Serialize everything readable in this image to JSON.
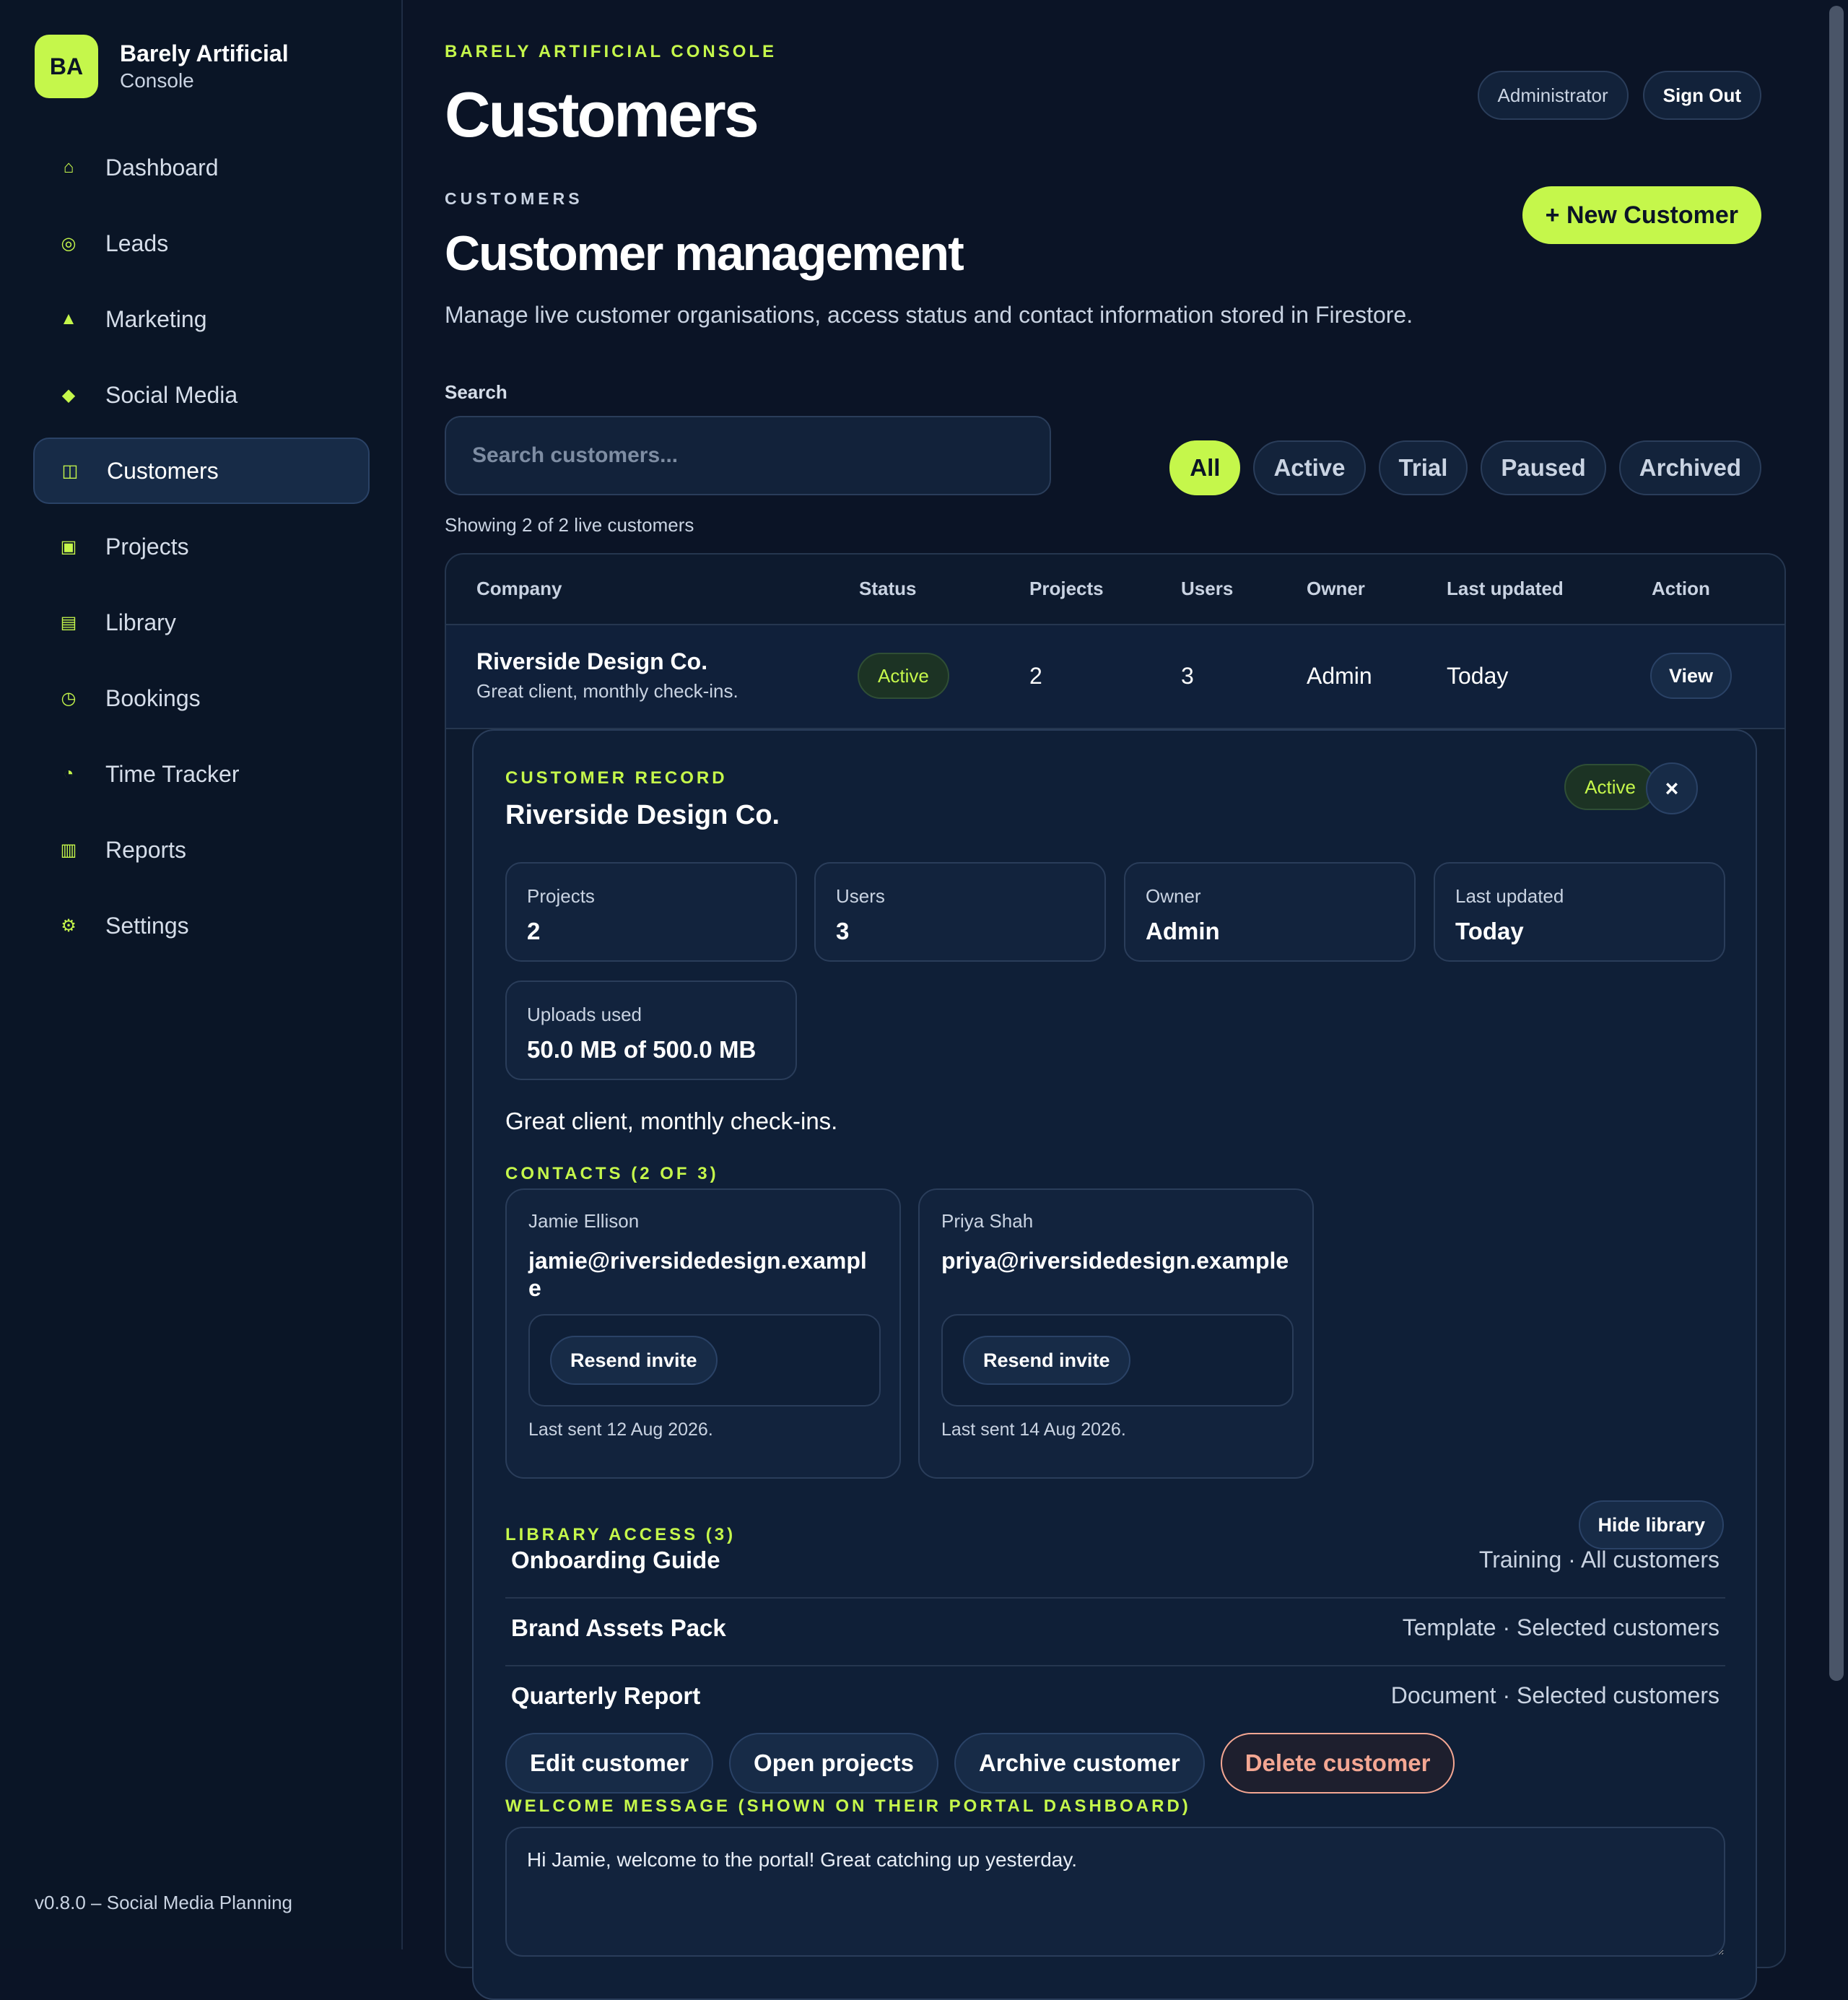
{
  "brand": {
    "logo": "BA",
    "name": "Barely Artificial",
    "sub": "Console"
  },
  "sidebar": {
    "items": [
      {
        "label": "Dashboard",
        "icon": "⌂"
      },
      {
        "label": "Leads",
        "icon": "◎"
      },
      {
        "label": "Marketing",
        "icon": "▲"
      },
      {
        "label": "Social Media",
        "icon": "◆"
      },
      {
        "label": "Customers",
        "icon": "◫"
      },
      {
        "label": "Projects",
        "icon": "▣"
      },
      {
        "label": "Library",
        "icon": "▤"
      },
      {
        "label": "Bookings",
        "icon": "◷"
      },
      {
        "label": "Time Tracker",
        "icon": "◔"
      },
      {
        "label": "Reports",
        "icon": "▥"
      },
      {
        "label": "Settings",
        "icon": "⚙"
      }
    ],
    "active": "Customers",
    "version": "v0.8.0 – Social Media Planning"
  },
  "header": {
    "console_label": "BARELY ARTIFICIAL CONSOLE",
    "title": "Customers",
    "role": "Administrator",
    "sign_out": "Sign Out"
  },
  "section": {
    "label": "CUSTOMERS",
    "title": "Customer management",
    "description": "Manage live customer organisations, access status and contact information stored in Firestore.",
    "new_button": "+ New Customer"
  },
  "search": {
    "label": "Search",
    "placeholder": "Search customers...",
    "value": ""
  },
  "filters": [
    "All",
    "Active",
    "Trial",
    "Paused",
    "Archived"
  ],
  "active_filter": "All",
  "showing": "Showing 2 of 2 live customers",
  "table": {
    "headers": [
      "Company",
      "Status",
      "Projects",
      "Users",
      "Owner",
      "Last updated",
      "Action"
    ],
    "rows": [
      {
        "company": "Riverside Design Co.",
        "note": "Great client, monthly check-ins.",
        "status": "Active",
        "projects": "2",
        "users": "3",
        "owner": "Admin",
        "updated": "Today",
        "action": "View"
      }
    ]
  },
  "record": {
    "eyebrow": "CUSTOMER RECORD",
    "title": "Riverside Design Co.",
    "status": "Active",
    "close": "×",
    "stats": [
      {
        "label": "Projects",
        "value": "2"
      },
      {
        "label": "Users",
        "value": "3"
      },
      {
        "label": "Owner",
        "value": "Admin"
      },
      {
        "label": "Last updated",
        "value": "Today"
      },
      {
        "label": "Uploads used",
        "value": "50.0 MB of 500.0 MB"
      }
    ],
    "note": "Great client, monthly check-ins.",
    "contacts_label": "CONTACTS (2 OF 3)",
    "contacts": [
      {
        "name": "Jamie Ellison",
        "email": "jamie@riversidedesign.example",
        "button": "Resend invite",
        "last_sent": "Last sent 12 Aug 2026."
      },
      {
        "name": "Priya Shah",
        "email": "priya@riversidedesign.example",
        "button": "Resend invite",
        "last_sent": "Last sent 14 Aug 2026."
      }
    ],
    "library_label": "LIBRARY ACCESS (3)",
    "hide_library": "Hide library",
    "library": [
      {
        "name": "Onboarding Guide",
        "meta": "Training · All customers"
      },
      {
        "name": "Brand Assets Pack",
        "meta": "Template · Selected customers"
      },
      {
        "name": "Quarterly Report",
        "meta": "Document · Selected customers"
      }
    ],
    "actions": {
      "edit": "Edit customer",
      "open": "Open projects",
      "archive": "Archive customer",
      "delete": "Delete customer"
    },
    "welcome_label": "WELCOME MESSAGE (SHOWN ON THEIR PORTAL DASHBOARD)",
    "welcome_value": "Hi Jamie, welcome to the portal! Great catching up yesterday."
  },
  "colors": {
    "accent": "#c5f74b",
    "background": "#0b1426",
    "danger": "#f4a793"
  }
}
